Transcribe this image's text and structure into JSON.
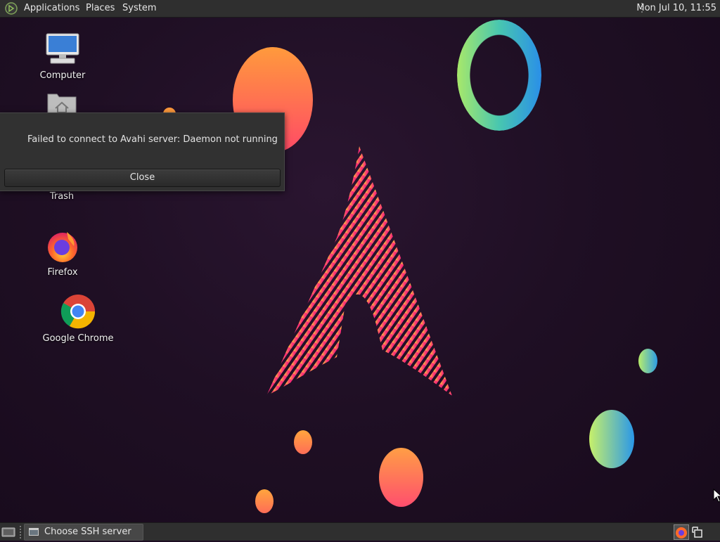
{
  "top_panel": {
    "menus": [
      "Applications",
      "Places",
      "System"
    ],
    "clock": "Mon Jul 10, 11:55"
  },
  "desktop_icons": [
    {
      "label": "Computer",
      "icon": "computer-icon"
    },
    {
      "label": "",
      "icon": "home-folder-icon"
    },
    {
      "label": "Trash",
      "icon": "trash-icon"
    },
    {
      "label": "Firefox",
      "icon": "firefox-icon"
    },
    {
      "label": "Google Chrome",
      "icon": "chrome-icon"
    }
  ],
  "dialog": {
    "message": "Failed to connect to Avahi server: Daemon not running",
    "close_label": "Close"
  },
  "bottom_panel": {
    "task_label": "Choose SSH server"
  },
  "colors": {
    "panel": "#2f2f2f",
    "wallpaper": "#1c0d22",
    "dialog": "#313131"
  }
}
